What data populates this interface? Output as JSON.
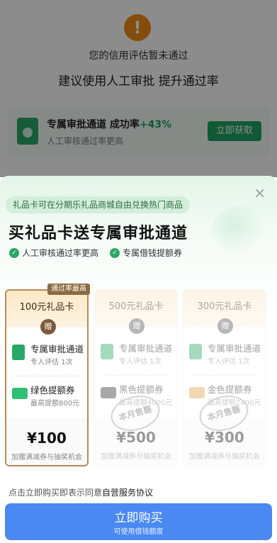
{
  "background": {
    "warn_icon": "!",
    "title": "您的信用评估暂未通过",
    "subtitle": "建议使用人工审批 提升通过率",
    "card": {
      "title": "专属审批通道 成功率",
      "rate": "+43%",
      "desc": "人工审核通过率更高",
      "button": "立即获取"
    }
  },
  "sheet": {
    "close": "×",
    "pill": "礼品卡可在分期乐礼品商城自由兑换热门商品",
    "headline": "买礼品卡送专属审批通道",
    "benefits": [
      "人工审核通过率更高",
      "专属借钱提额券"
    ],
    "cards": [
      {
        "badge": "通过率最高",
        "name": "100元礼品卡",
        "gift": "赠",
        "row1_title": "专属审批通道",
        "row1_desc": "专人评估 1次",
        "row2_title": "绿色提额券",
        "row2_desc": "最高提额800元",
        "price": "¥100",
        "note": "加赠满减券与抽奖机会"
      },
      {
        "name": "500元礼品卡",
        "gift": "赠",
        "row1_title": "专属审批通道",
        "row1_desc": "专人评估 1次",
        "row2_title": "黑色提额券",
        "row2_desc": "最高提额4000元",
        "price": "¥500",
        "note": "加赠满减券与抽奖机会",
        "stamp": "本月售罄"
      },
      {
        "name": "300元礼品卡",
        "gift": "赠",
        "row1_title": "专属审批通道",
        "row1_desc": "专人评估 1次",
        "row2_title": "金色提额券",
        "row2_desc": "最高提额2400元",
        "price": "¥300",
        "note": "加赠满减券与抽奖机会",
        "stamp": "本月售罄"
      }
    ],
    "agreement_prefix": "点击立即购买即表示同意",
    "agreement_link": "自营服务协议",
    "buy_button": "立即购买",
    "buy_sub": "可使用借钱额度"
  },
  "colors": {
    "accent_green": "#1ea35f",
    "buy_blue": "#4a88f2",
    "warn_orange": "#f08c16",
    "card_border": "#b78a58"
  }
}
